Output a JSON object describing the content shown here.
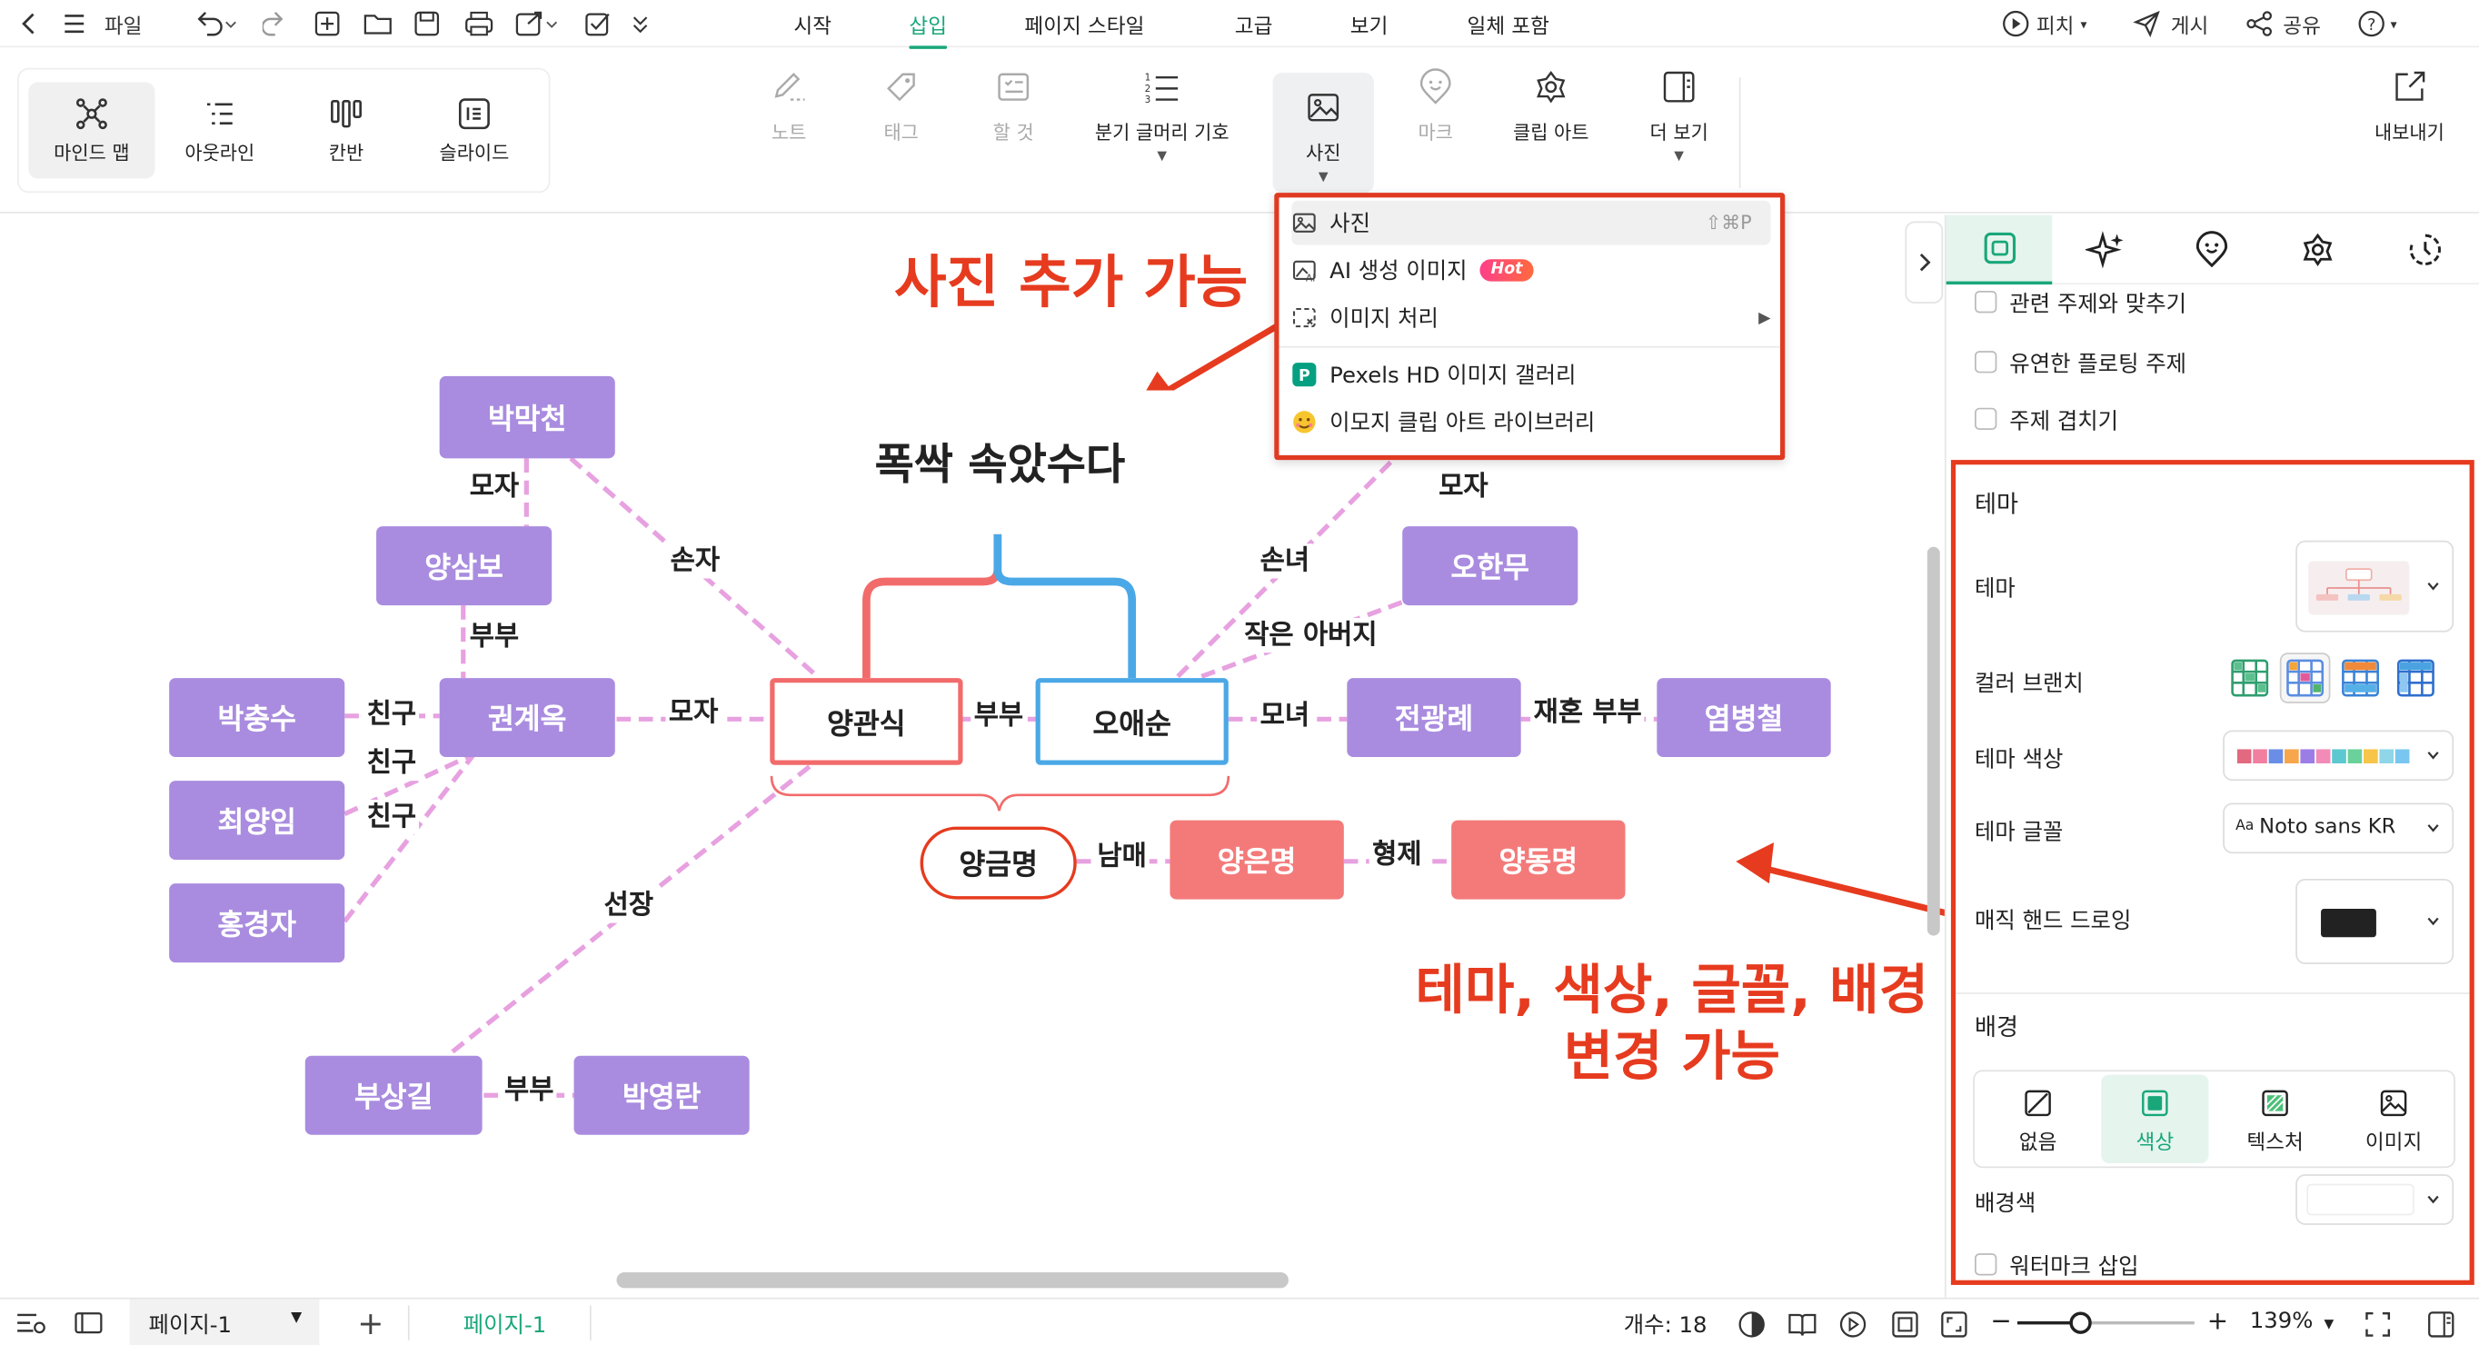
{
  "menubar": {
    "file": "파일",
    "tabs": [
      {
        "label": "시작"
      },
      {
        "label": "삽입"
      },
      {
        "label": "페이지 스타일"
      },
      {
        "label": "고급"
      },
      {
        "label": "보기"
      },
      {
        "label": "일체 포함"
      }
    ],
    "active_tab": "삽입",
    "pitch": "피치",
    "post": "게시",
    "share": "공유"
  },
  "views": [
    {
      "label": "마인드 맵"
    },
    {
      "label": "아웃라인"
    },
    {
      "label": "칸반"
    },
    {
      "label": "슬라이드"
    }
  ],
  "ribbon": {
    "note": "노트",
    "tag": "태그",
    "todo": "할 것",
    "branch_symbol": "분기 글머리 기호",
    "photo": "사진",
    "mark": "마크",
    "clipart": "클립 아트",
    "more": "더 보기",
    "export": "내보내기"
  },
  "dropdown": {
    "items": [
      {
        "label": "사진",
        "shortcut": "⇧⌘P"
      },
      {
        "label": "AI 생성 이미지",
        "badge": "Hot"
      },
      {
        "label": "이미지 처리"
      },
      {
        "label": "Pexels HD 이미지 갤러리"
      },
      {
        "label": "이모지 클립 아트 라이브러리"
      }
    ]
  },
  "annotations": {
    "photo_add": "사진 추가 가능",
    "theme_change_line1": "테마, 색상, 글꼴, 배경",
    "theme_change_line2": "변경 가능"
  },
  "mindmap": {
    "central_topic": "폭싹 속았수다",
    "nodes": {
      "yang_gwansik": "양관식",
      "oh_aesun": "오애순",
      "yang_geummyeong": "양금명",
      "yang_eunmyeong": "양은명",
      "yang_dongmyeong": "양동명",
      "bak_makcheon": "박막천",
      "yang_sambo": "양삼보",
      "gwon_gyeok": "권계옥",
      "bak_chungsu": "박충수",
      "choe_yangim": "최양임",
      "hong_gyeongja": "홍경자",
      "bu_sanggil": "부상길",
      "bak_yeongran": "박영란",
      "oh_hanmu": "오한무",
      "jeon_gwangrye": "전광례",
      "yeom_byeongcheol": "염병철"
    },
    "relations": {
      "moja_top": "모자",
      "sonja": "손자",
      "bubu_left": "부부",
      "friend1": "친구",
      "friend2": "친구",
      "friend3": "친구",
      "moja_mid": "모자",
      "bubu_center": "부부",
      "seonjang": "선장",
      "bubu_bottom": "부부",
      "sonnyeo": "손녀",
      "moja_right": "모자",
      "small_father": "작은 아버지",
      "monyeo": "모녀",
      "remarried": "재혼 부부",
      "nammae": "남매",
      "hyeongje": "형제"
    }
  },
  "sidepanel": {
    "checkboxes": [
      {
        "label": "관련 주제와 맞추기"
      },
      {
        "label": "유연한 플로팅 주제"
      },
      {
        "label": "주제 겹치기"
      }
    ],
    "theme_section": "테마",
    "theme_label": "테마",
    "color_branch": "컬러 브랜치",
    "theme_color": "테마 색상",
    "theme_font": "테마 글꼴",
    "font_value": "Noto sans KR",
    "font_prefix": "Aa",
    "magic_hand": "매직 핸드 드로잉",
    "background_section": "배경",
    "bg_options": [
      {
        "label": "없음"
      },
      {
        "label": "색상"
      },
      {
        "label": "텍스처"
      },
      {
        "label": "이미지"
      }
    ],
    "bg_color": "배경색",
    "watermark": "워터마크 삽입"
  },
  "statusbar": {
    "page_select": "페이지-1",
    "page_tab": "페이지-1",
    "count_label": "개수: 18",
    "zoom": "139%"
  },
  "colors": {
    "accent": "#19a77a",
    "node_purple": "#a98cdf",
    "node_red": "#f47a7a",
    "annotation_red": "#e63b1f",
    "gwansik_red": "#f26b6b",
    "aesun_blue": "#4ba8e6",
    "connector_pink": "#e7a1e0"
  }
}
